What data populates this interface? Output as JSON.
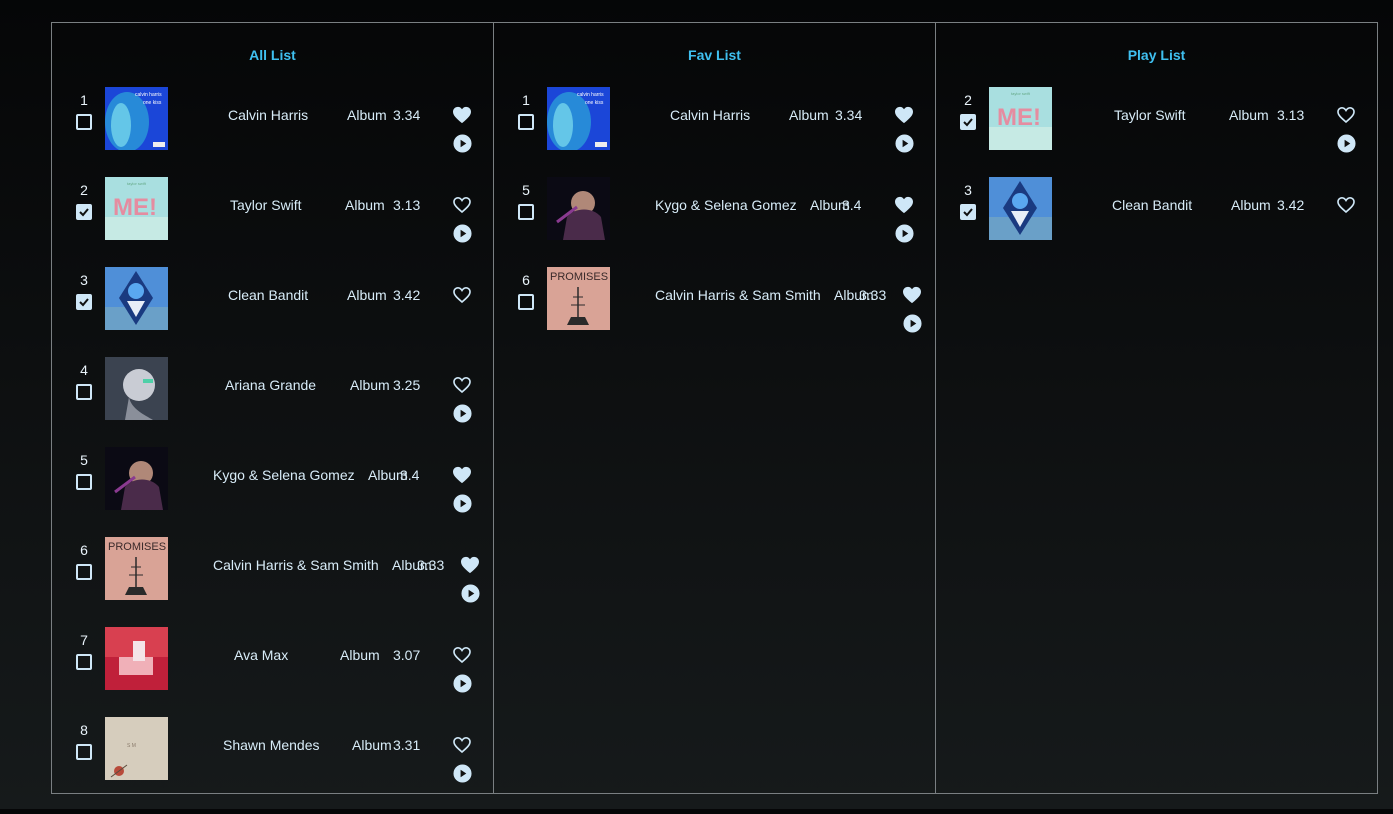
{
  "panels": [
    {
      "title": "All List",
      "items": [
        {
          "num": "1",
          "checked": false,
          "artist": "Calvin Harris",
          "album": "Album",
          "duration": "3.34",
          "fav": true,
          "play": true,
          "cover": "blue-waves"
        },
        {
          "num": "2",
          "checked": true,
          "artist": "Taylor Swift",
          "album": "Album",
          "duration": "3.13",
          "fav": false,
          "play": true,
          "cover": "pastel-me"
        },
        {
          "num": "3",
          "checked": true,
          "artist": "Clean Bandit",
          "album": "Album",
          "duration": "3.42",
          "fav": false,
          "play": false,
          "cover": "diamond-sky"
        },
        {
          "num": "4",
          "checked": false,
          "artist": "Ariana Grande",
          "album": "Album",
          "duration": "3.25",
          "fav": false,
          "play": true,
          "cover": "grey-portrait"
        },
        {
          "num": "5",
          "checked": false,
          "artist": "Kygo & Selena Gomez",
          "album": "Album",
          "duration": "3.4",
          "fav": true,
          "play": true,
          "cover": "dark-portrait"
        },
        {
          "num": "6",
          "checked": false,
          "artist": "Calvin Harris & Sam Smith",
          "album": "Album",
          "duration": "3.33",
          "fav": true,
          "play": true,
          "cover": "promises"
        },
        {
          "num": "7",
          "checked": false,
          "artist": "Ava Max",
          "album": "Album",
          "duration": "3.07",
          "fav": false,
          "play": true,
          "cover": "red-room"
        },
        {
          "num": "8",
          "checked": false,
          "artist": "Shawn Mendes",
          "album": "Album",
          "duration": "3.31",
          "fav": false,
          "play": true,
          "cover": "beige-rose"
        }
      ]
    },
    {
      "title": "Fav List",
      "items": [
        {
          "num": "1",
          "checked": false,
          "artist": "Calvin Harris",
          "album": "Album",
          "duration": "3.34",
          "fav": true,
          "play": true,
          "cover": "blue-waves"
        },
        {
          "num": "5",
          "checked": false,
          "artist": "Kygo & Selena Gomez",
          "album": "Album",
          "duration": "3.4",
          "fav": true,
          "play": true,
          "cover": "dark-portrait"
        },
        {
          "num": "6",
          "checked": false,
          "artist": "Calvin Harris & Sam Smith",
          "album": "Album",
          "duration": "3.33",
          "fav": true,
          "play": true,
          "cover": "promises"
        }
      ]
    },
    {
      "title": "Play List",
      "items": [
        {
          "num": "2",
          "checked": true,
          "artist": "Taylor Swift",
          "album": "Album",
          "duration": "3.13",
          "fav": false,
          "play": true,
          "cover": "pastel-me"
        },
        {
          "num": "3",
          "checked": true,
          "artist": "Clean Bandit",
          "album": "Album",
          "duration": "3.42",
          "fav": false,
          "play": false,
          "cover": "diamond-sky"
        }
      ]
    }
  ],
  "colors": {
    "title": "#3fc0f0",
    "text": "#d8ecf8",
    "icon": "#cfe7f7",
    "border": "#7a7f82"
  }
}
